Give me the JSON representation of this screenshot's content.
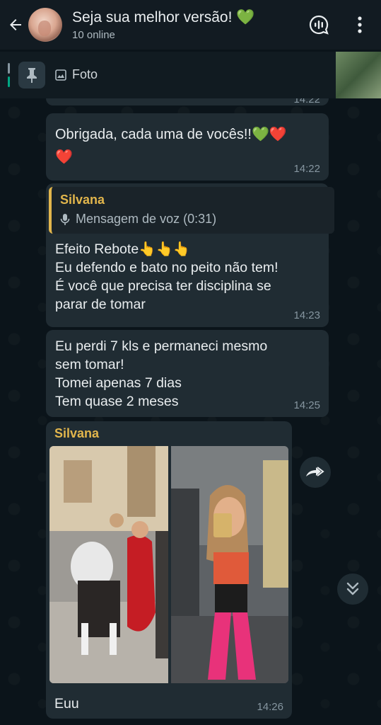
{
  "header": {
    "title": "Seja sua melhor versão! 💚",
    "subtitle": "10 online"
  },
  "pinned": {
    "label": "Foto"
  },
  "messages": [
    {
      "text": "Obrigada, cada uma de vocês!!💚❤️\n❤️",
      "time": "14:22"
    },
    {
      "quote": {
        "name": "Silvana",
        "text": "Mensagem de voz (0:31)"
      },
      "text": "Efeito Rebote👆👆👆\nEu defendo e bato no peito não tem!\nÉ você que precisa ter disciplina se\nparar de tomar",
      "time": "14:23"
    },
    {
      "text": "Eu perdi 7 kls e permaneci mesmo\nsem tomar!\nTomei apenas 7 dias\nTem quase 2 meses",
      "time": "14:25"
    },
    {
      "sender": "Silvana",
      "caption": "Euu",
      "time": "14:26"
    }
  ],
  "partial_time": "14:22",
  "colors": {
    "background": "#0b141a",
    "bubble": "#202c33",
    "header": "#121b22",
    "accent_green": "#00a884",
    "sender_name": "#e2b64c"
  },
  "icons": [
    "back-arrow-icon",
    "voice-chat-icon",
    "more-vert-icon",
    "pin-icon",
    "image-icon",
    "mic-icon",
    "forward-icon",
    "chevron-double-down-icon"
  ]
}
